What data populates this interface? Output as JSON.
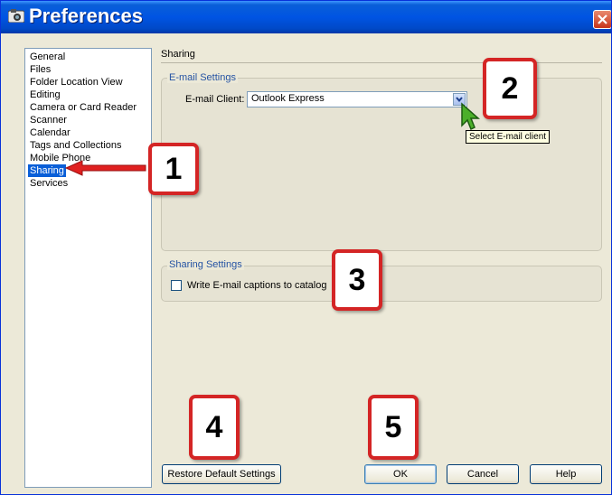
{
  "window": {
    "title": "Preferences"
  },
  "sidebar": {
    "items": [
      {
        "label": "General",
        "selected": false
      },
      {
        "label": "Files",
        "selected": false
      },
      {
        "label": "Folder Location View",
        "selected": false
      },
      {
        "label": "Editing",
        "selected": false
      },
      {
        "label": "Camera or Card Reader",
        "selected": false
      },
      {
        "label": "Scanner",
        "selected": false
      },
      {
        "label": "Calendar",
        "selected": false
      },
      {
        "label": "Tags and Collections",
        "selected": false
      },
      {
        "label": "Mobile Phone",
        "selected": false
      },
      {
        "label": "Sharing",
        "selected": true
      },
      {
        "label": "Services",
        "selected": false
      }
    ]
  },
  "panel": {
    "heading": "Sharing"
  },
  "email_settings": {
    "group_title": "E-mail Settings",
    "client_label": "E-mail Client:",
    "client_value": "Outlook Express",
    "tooltip": "Select E-mail client"
  },
  "sharing_settings": {
    "group_title": "Sharing Settings",
    "checkbox_label": "Write E-mail captions to catalog",
    "checked": false
  },
  "buttons": {
    "restore": "Restore Default Settings",
    "ok": "OK",
    "cancel": "Cancel",
    "help": "Help"
  },
  "callouts": [
    "1",
    "2",
    "3",
    "4",
    "5"
  ],
  "colors": {
    "callout_border": "#d42525",
    "selection": "#0a5fd8",
    "title_bar": "#0054e3",
    "group_title": "#2553a3"
  }
}
